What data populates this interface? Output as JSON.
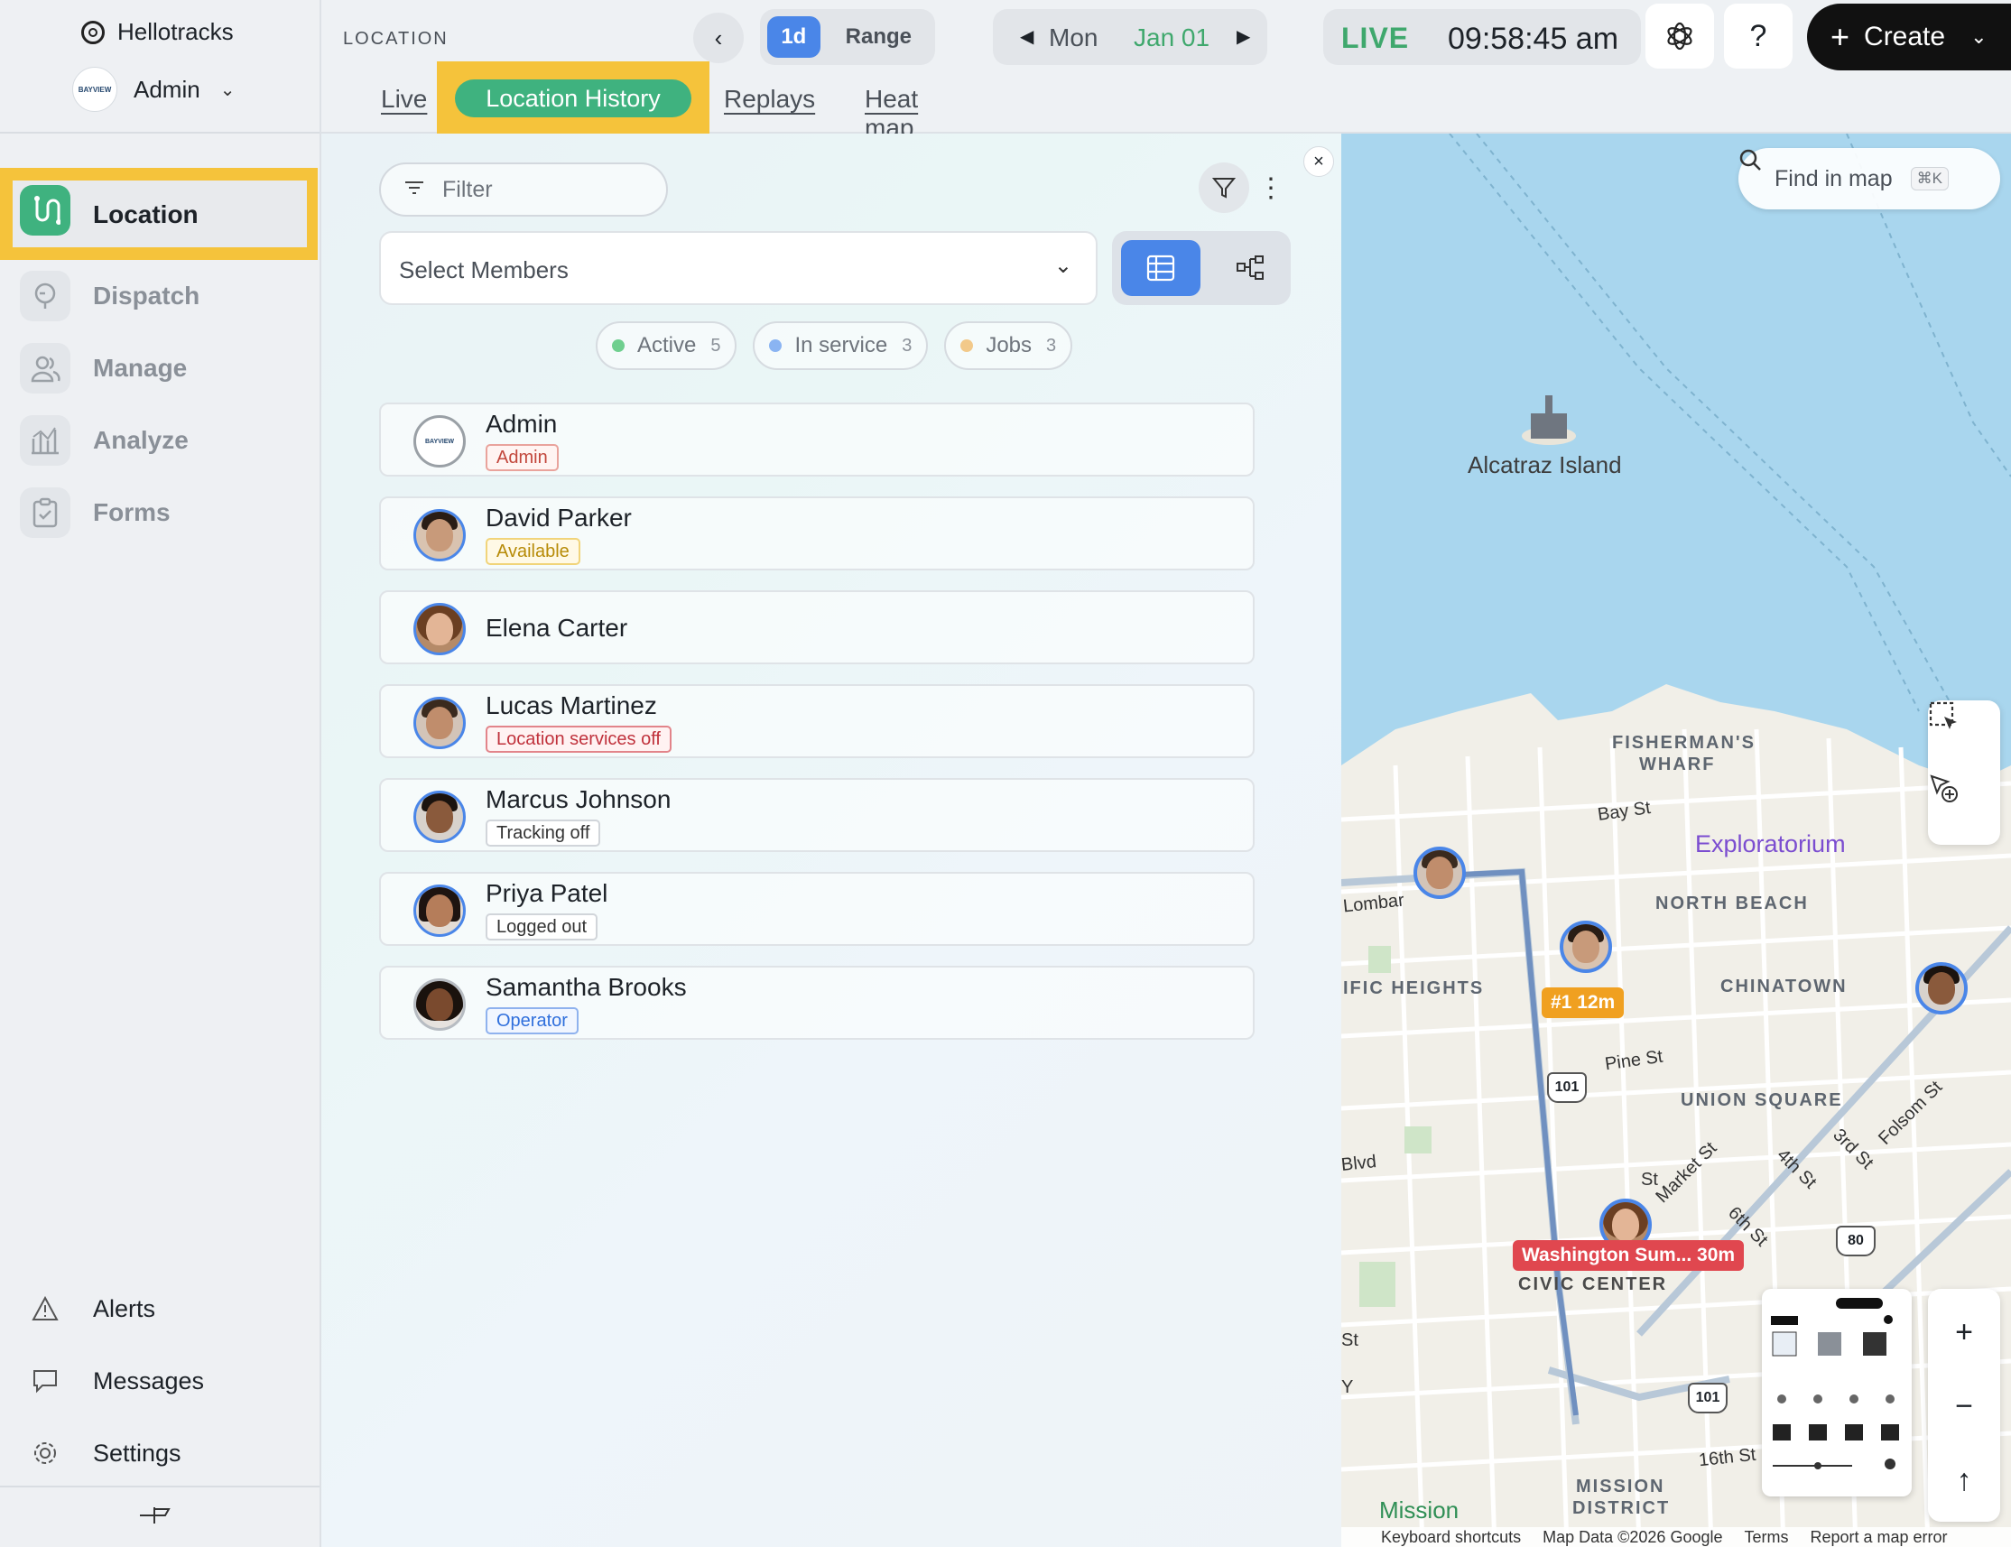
{
  "sidebar": {
    "brand": "Hellotracks",
    "org": {
      "name": "Admin",
      "logo_text": "BAYVIEW"
    },
    "nav": [
      {
        "label": "Location",
        "icon": "route-icon",
        "active": true
      },
      {
        "label": "Dispatch",
        "icon": "dispatch-icon",
        "active": false
      },
      {
        "label": "Manage",
        "icon": "users-icon",
        "active": false
      },
      {
        "label": "Analyze",
        "icon": "chart-icon",
        "active": false
      },
      {
        "label": "Forms",
        "icon": "clipboard-icon",
        "active": false
      }
    ],
    "bottom": [
      {
        "label": "Alerts",
        "icon": "alert-icon"
      },
      {
        "label": "Messages",
        "icon": "messages-icon"
      },
      {
        "label": "Settings",
        "icon": "gear-icon"
      }
    ]
  },
  "topbar": {
    "section": "LOCATION",
    "range": {
      "active": "1d",
      "other": "Range"
    },
    "date": {
      "day": "Mon",
      "date": "Jan 01"
    },
    "live": "LIVE",
    "clock": "09:58:45 am",
    "help": "?",
    "create": "Create",
    "tabs": [
      {
        "label": "Live"
      },
      {
        "label": "Location History",
        "active": true
      },
      {
        "label": "Replays"
      },
      {
        "label": "Heat map"
      }
    ]
  },
  "panel": {
    "filter_placeholder": "Filter",
    "members_placeholder": "Select Members",
    "chips": [
      {
        "label": "Active",
        "count": "5",
        "color": "#6fcf8f"
      },
      {
        "label": "In service",
        "count": "3",
        "color": "#8ab4f2"
      },
      {
        "label": "Jobs",
        "count": "3",
        "color": "#f2c98a"
      }
    ],
    "members": [
      {
        "name": "Admin",
        "badge": "Admin",
        "badge_style": "admin"
      },
      {
        "name": "David Parker",
        "badge": "Available",
        "badge_style": "available"
      },
      {
        "name": "Elena Carter",
        "badge": "",
        "badge_style": ""
      },
      {
        "name": "Lucas Martinez",
        "badge": "Location services off",
        "badge_style": "locoff"
      },
      {
        "name": "Marcus Johnson",
        "badge": "Tracking off",
        "badge_style": "neutral"
      },
      {
        "name": "Priya Patel",
        "badge": "Logged out",
        "badge_style": "neutral"
      },
      {
        "name": "Samantha Brooks",
        "badge": "Operator",
        "badge_style": "operator"
      }
    ]
  },
  "map": {
    "search_placeholder": "Find in map",
    "search_shortcut": "⌘K",
    "labels": {
      "alcatraz": "Alcatraz Island",
      "fishermans": "FISHERMAN'S",
      "wharf": "WHARF",
      "exploratorium": "Exploratorium",
      "north_beach": "NORTH BEACH",
      "chinatown": "CHINATOWN",
      "union_square": "UNION SQUARE",
      "pacific_heights": "IFIC HEIGHTS",
      "mission_district": "MISSION",
      "mission_district2": "DISTRICT",
      "mission": "Mission",
      "civic_center": "CIVIC CENTER"
    },
    "streets": {
      "bay": "Bay St",
      "lombard": "Lombar",
      "pine": "Pine St",
      "market": "Market St",
      "fourth": "4th St",
      "third": "3rd St",
      "folsom": "Folsom St",
      "sixth": "6th St",
      "sixteenth": "16th St",
      "blvd": "Blvd",
      "st": "St",
      "st2": "St",
      "y": "Y"
    },
    "highways": [
      "101",
      "101",
      "80"
    ],
    "tags": {
      "orange": "#1 12m",
      "red": "Washington Sum... 30m"
    },
    "footer": [
      "Keyboard shortcuts",
      "Map Data ©2026 Google",
      "Terms",
      "Report a map error"
    ]
  }
}
